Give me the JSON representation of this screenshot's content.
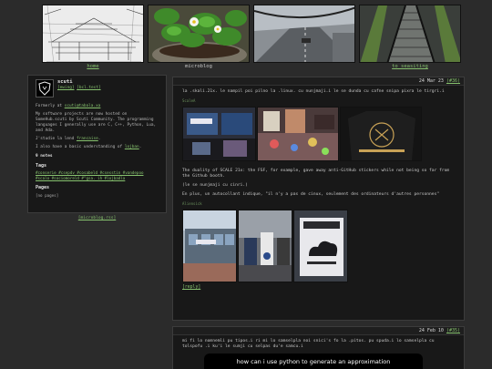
{
  "gallery": [
    {
      "caption": "home"
    },
    {
      "caption": "microblog"
    },
    {
      "caption": ""
    },
    {
      "caption": "to seasiting"
    }
  ],
  "sidebar": {
    "name": "scuti",
    "links": [
      "[ewing]",
      "[bcl.test]"
    ],
    "bio_prefix": "Formerly at ",
    "bio_link": "scuti@tabala.xa",
    "projects_text": "My software projects are now hosted on SomeHub.scuti by Scuti Community. The programming languages I generally use are C, C++, Python, Lua, and Ada.",
    "studio_text": "J'studie la lend",
    "studio_link": "francaise",
    "lojban_text": "I also have a basic understanding of",
    "lojban_link": "lojban",
    "notes_count": "9 notes",
    "tags_heading": "Tags",
    "tags_text": "#conserie #csepdv #cosabeld #csesstin #vandepoo #scalo #sociomoreld #\"gsa. ih #lojbadla",
    "pages_heading": "Pages",
    "pages_text": "[no pages]",
    "footer_link": "[microblog.rss]"
  },
  "post1": {
    "date": "24 Mar 23",
    "ref": "(#36)",
    "text1": "la .skali.21x. le nampil poi pilno la .linux. cu nunjmaji.i le se dunda cu cafne snipa pixra le tirgri.i",
    "alt1": "ScaleA",
    "text2": "The duality of SCALE 21x: the FSF, for example, gave away anti-GitHub stickers while not being so far from the Github booth.",
    "text3": "(le se nunjmaji cu cinri.)",
    "text4": "En plus, un autocollant indique, \"il n'y a pas de cinux, seulement des ordinateurs d'autres personnes\"",
    "alt2": "Aliensick",
    "reply": "[reply]"
  },
  "post2": {
    "date": "24 Feb 10",
    "ref": "(#35)",
    "text1": "mi fi lo nomnemli pu tipos.i ri mi lo samselpla noi snici's fo la .pitos. pu spuda.i lo samselpla cu tolspofu .i ku'i le sumji cu selpas du'e samcu.i",
    "video_title": "how can i use python to generate an approximation"
  }
}
